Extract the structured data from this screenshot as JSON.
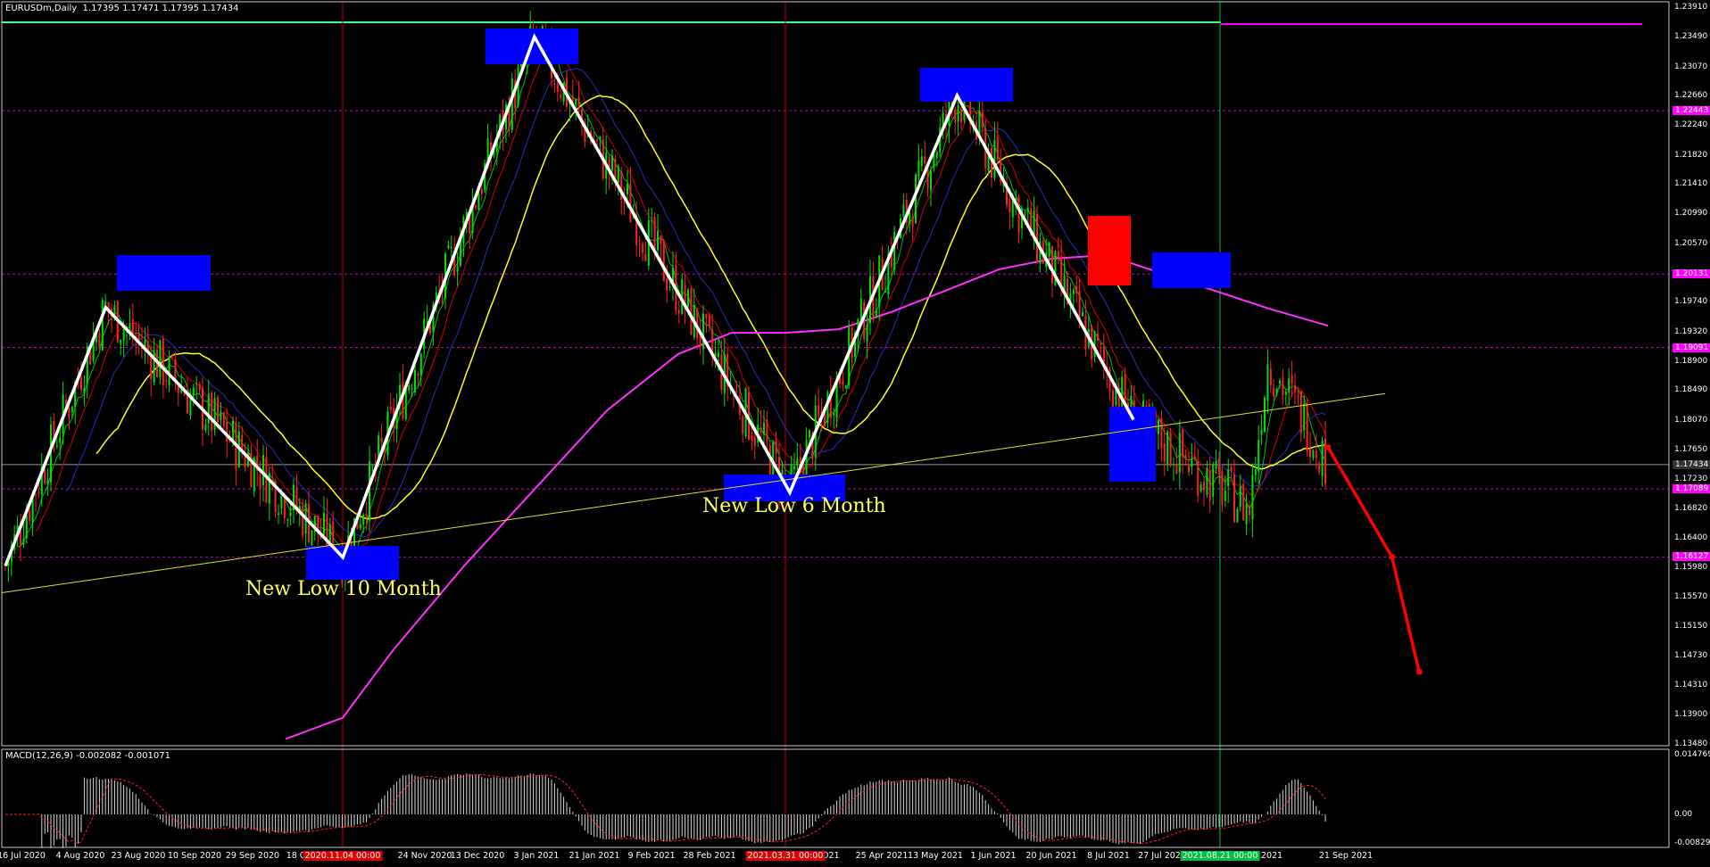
{
  "header": {
    "main": "EURUSDm,Daily  1.17395 1.17471 1.17395 1.17434",
    "macd": "MACD(12,26,9) -0.002082 -0.001071"
  },
  "price_axis": [
    "1.23910",
    "1.23490",
    "1.23070",
    "1.22660",
    "1.22240",
    "1.21820",
    "1.21410",
    "1.20990",
    "1.20570",
    "1.19740",
    "1.19320",
    "1.18900",
    "1.18490",
    "1.18070",
    "1.17650",
    "1.17230",
    "1.16820",
    "1.16400",
    "1.15980",
    "1.15570",
    "1.15150",
    "1.14730",
    "1.14310",
    "1.13900",
    "1.13480"
  ],
  "price_tags": [
    {
      "label": "1.22443",
      "color": "#ff00ff"
    },
    {
      "label": "1.20131",
      "color": "#ff00ff"
    },
    {
      "label": "1.19091",
      "color": "#ff00ff"
    },
    {
      "label": "1.17434",
      "color": "#333333"
    },
    {
      "label": "1.17089",
      "color": "#ff00ff"
    },
    {
      "label": "1.16127",
      "color": "#ff00ff"
    }
  ],
  "macd_axis": [
    "0.014769",
    "0.00",
    "-0.008294"
  ],
  "date_axis": [
    "16 Jul 2020",
    "4 Aug 2020",
    "23 Aug 2020",
    "10 Sep 2020",
    "29 Sep 2020",
    "18 O",
    "24 Nov 2020",
    "13 Dec 2020",
    "3 Jan 2021",
    "21 Jan 2021",
    "9 Feb 2021",
    "28 Feb 2021",
    "1",
    "r 2021",
    "25 Apr 2021",
    "13 May 2021",
    "1 Jun 2021",
    "20 Jun 2021",
    "8 Jul 2021",
    "27 Jul 2021",
    "2 Sep 2021",
    "21 Sep 2021"
  ],
  "date_markers": [
    {
      "label": "2020.11.04 00:00",
      "color": "#e00000"
    },
    {
      "label": "2021.03.31 00:00",
      "color": "#e00000"
    },
    {
      "label": "2021.08.21 00:00",
      "color": "#00c040"
    }
  ],
  "annotations": {
    "low10": "New Low 10 Month",
    "low6": "New Low 6 Month"
  },
  "chart_data": {
    "type": "candlestick",
    "symbol": "EURUSDm",
    "timeframe": "Daily",
    "ohlc_last": {
      "open": 1.17395,
      "high": 1.17471,
      "low": 1.17395,
      "close": 1.17434
    },
    "y_range": [
      1.1348,
      1.2391
    ],
    "x_range": [
      "2020-07-16",
      "2021-09-24"
    ],
    "horizontal_levels": [
      1.22443,
      1.20131,
      1.19091,
      1.17089,
      1.16127
    ],
    "current_price": 1.17434,
    "zigzag": [
      {
        "date": "2020-07-16",
        "price": 1.16
      },
      {
        "date": "2020-08-18",
        "price": 1.1966
      },
      {
        "date": "2020-11-04",
        "price": 1.1612
      },
      {
        "date": "2021-01-06",
        "price": 1.2349
      },
      {
        "date": "2021-03-31",
        "price": 1.1704
      },
      {
        "date": "2021-05-25",
        "price": 1.2266
      },
      {
        "date": "2021-07-22",
        "price": 1.1807
      }
    ],
    "forecast": [
      {
        "date": "2021-09-24",
        "price": 1.1768
      },
      {
        "date": "2021-10-15",
        "price": 1.1613
      },
      {
        "date": "2021-10-24",
        "price": 1.145
      }
    ],
    "macd": {
      "params": "12,26,9",
      "main": -0.002082,
      "signal": -0.001071,
      "range": [
        -0.008294,
        0.014769
      ]
    }
  }
}
